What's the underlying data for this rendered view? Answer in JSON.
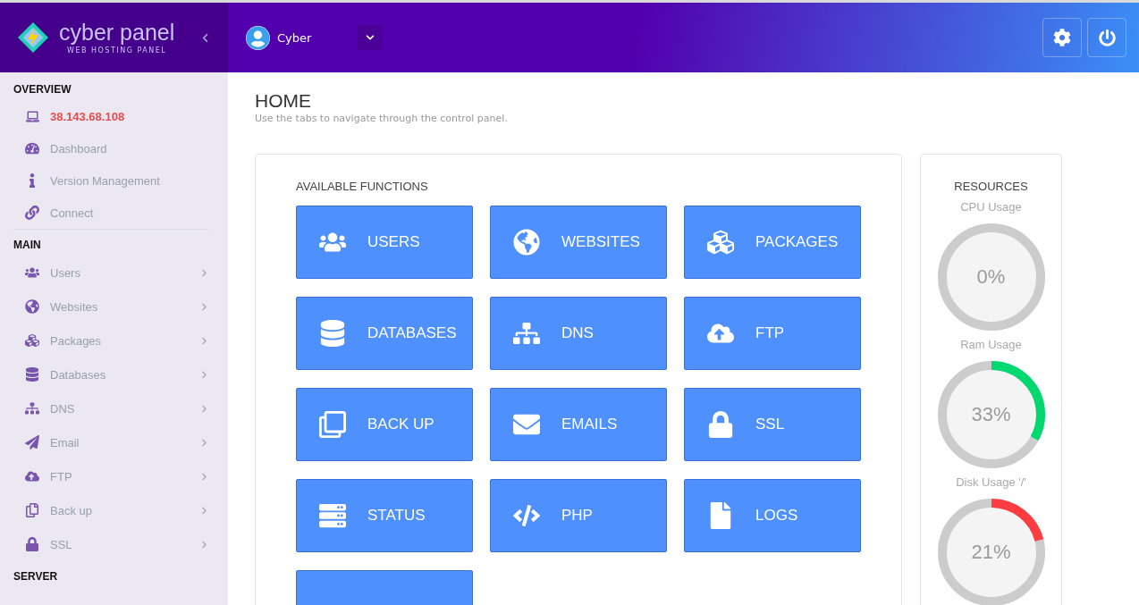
{
  "brand": {
    "name": "cyber panel",
    "tagline": "WEB HOSTING PANEL"
  },
  "user": {
    "name": "Cyber"
  },
  "sidebar": {
    "sections": [
      {
        "title": "OVERVIEW",
        "items": [
          {
            "label": "38.143.68.108",
            "kind": "address"
          },
          {
            "label": "Dashboard",
            "kind": "link"
          },
          {
            "label": "Version Management",
            "kind": "link"
          },
          {
            "label": "Connect",
            "kind": "link"
          }
        ]
      },
      {
        "title": "MAIN",
        "items": [
          {
            "label": "Users",
            "kind": "submenu"
          },
          {
            "label": "Websites",
            "kind": "submenu"
          },
          {
            "label": "Packages",
            "kind": "submenu"
          },
          {
            "label": "Databases",
            "kind": "submenu"
          },
          {
            "label": "DNS",
            "kind": "submenu"
          },
          {
            "label": "Email",
            "kind": "submenu"
          },
          {
            "label": "FTP",
            "kind": "submenu"
          },
          {
            "label": "Back up",
            "kind": "submenu"
          },
          {
            "label": "SSL",
            "kind": "submenu"
          }
        ]
      },
      {
        "title": "SERVER"
      }
    ]
  },
  "page": {
    "title": "HOME",
    "subtitle": "Use the tabs to navigate through the control panel."
  },
  "functions": {
    "title": "AVAILABLE FUNCTIONS",
    "tiles": [
      {
        "label": "USERS"
      },
      {
        "label": "WEBSITES"
      },
      {
        "label": "PACKAGES"
      },
      {
        "label": "DATABASES"
      },
      {
        "label": "DNS"
      },
      {
        "label": "FTP"
      },
      {
        "label": "BACK UP"
      },
      {
        "label": "EMAILS"
      },
      {
        "label": "SSL"
      },
      {
        "label": "STATUS"
      },
      {
        "label": "PHP"
      },
      {
        "label": "LOGS"
      }
    ]
  },
  "resources": {
    "title": "RESOURCES",
    "gauges": [
      {
        "label": "CPU Usage",
        "reading": "0%"
      },
      {
        "label": "Ram Usage",
        "reading": "33%",
        "level": 0.33,
        "color": "#00d96f"
      },
      {
        "label": "Disk Usage '/'",
        "reading": "21%",
        "level": 0.21,
        "color": "#ff3c41"
      }
    ]
  }
}
